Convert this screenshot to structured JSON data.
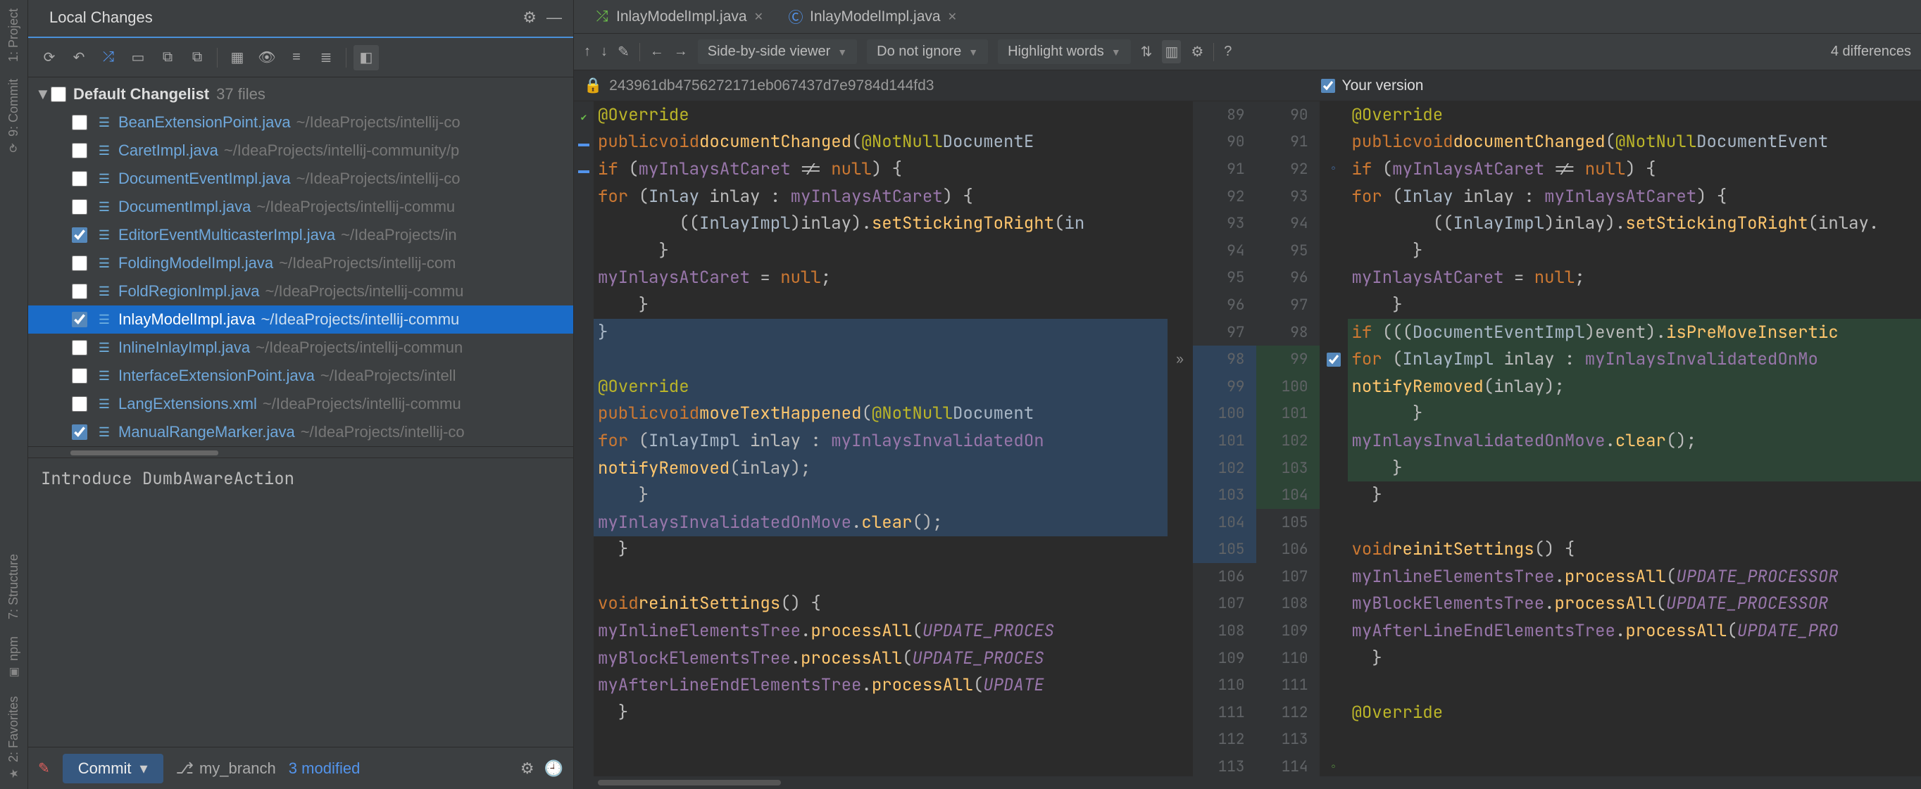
{
  "leftRail": {
    "project": "1: Project",
    "commit": "9: Commit",
    "structure": "7: Structure",
    "npm": "npm",
    "favorites": "2: Favorites"
  },
  "panel": {
    "title": "Local Changes"
  },
  "changelist": {
    "label": "Default Changelist",
    "count": "37 files"
  },
  "files": [
    {
      "name": "BeanExtensionPoint.java",
      "path": "~/IdeaProjects/intellij-co",
      "checked": false
    },
    {
      "name": "CaretImpl.java",
      "path": "~/IdeaProjects/intellij-community/p",
      "checked": false
    },
    {
      "name": "DocumentEventImpl.java",
      "path": "~/IdeaProjects/intellij-co",
      "checked": false
    },
    {
      "name": "DocumentImpl.java",
      "path": "~/IdeaProjects/intellij-commu",
      "checked": false
    },
    {
      "name": "EditorEventMulticasterImpl.java",
      "path": "~/IdeaProjects/in",
      "checked": true
    },
    {
      "name": "FoldingModelImpl.java",
      "path": "~/IdeaProjects/intellij-com",
      "checked": false
    },
    {
      "name": "FoldRegionImpl.java",
      "path": "~/IdeaProjects/intellij-commu",
      "checked": false
    },
    {
      "name": "InlayModelImpl.java",
      "path": "~/IdeaProjects/intellij-commu",
      "checked": true,
      "selected": true
    },
    {
      "name": "InlineInlayImpl.java",
      "path": "~/IdeaProjects/intellij-commun",
      "checked": false
    },
    {
      "name": "InterfaceExtensionPoint.java",
      "path": "~/IdeaProjects/intell",
      "checked": false
    },
    {
      "name": "LangExtensions.xml",
      "path": "~/IdeaProjects/intellij-commu",
      "checked": false
    },
    {
      "name": "ManualRangeMarker.java",
      "path": "~/IdeaProjects/intellij-co",
      "checked": true
    }
  ],
  "commitMessage": "Introduce DumbAwareAction",
  "footer": {
    "commitLabel": "Commit",
    "branch": "my_branch",
    "modified": "3 modified"
  },
  "tabs": [
    {
      "name": "InlayModelImpl.java",
      "iconColor": "green"
    },
    {
      "name": "InlayModelImpl.java",
      "iconColor": "blue"
    }
  ],
  "diffToolbar": {
    "viewer": "Side-by-side viewer",
    "ignore": "Do not ignore",
    "highlight": "Highlight words",
    "diffCount": "4 differences"
  },
  "diffHeader": {
    "leftRevision": "243961db4756272171eb067437d7e9784d144fd3",
    "right": "Your version"
  },
  "leftLines": [
    89,
    90,
    91,
    92,
    93,
    94,
    95,
    96,
    97,
    98,
    99,
    100,
    101,
    102,
    103,
    104,
    105,
    106,
    107,
    108,
    109,
    110,
    111,
    112,
    113
  ],
  "rightLines": [
    90,
    91,
    92,
    93,
    94,
    95,
    96,
    97,
    98,
    99,
    100,
    101,
    102,
    103,
    104,
    105,
    106,
    107,
    108,
    109,
    110,
    111,
    112,
    113,
    114
  ],
  "code": {
    "override": "@Override",
    "public": "public",
    "void": "void",
    "documentChanged": "documentChanged",
    "notNull": "@NotNull",
    "DocumentEvent": "DocumentEvent",
    "DocumentE": "DocumentE",
    "if": "if",
    "myInlaysAtCaret": "myInlaysAtCaret",
    "null": "null",
    "for": "for",
    "Inlay": "Inlay",
    "inlay": "inlay",
    "InlayImpl": "InlayImpl",
    "setStickingToRight": "setStickingToRight",
    "in": "in",
    "inlayDot": "inlay.",
    "moveTextHappened": "moveTextHappened",
    "Document": "Document",
    "myInlaysInvalidatedOn": "myInlaysInvalidatedOn",
    "myInlaysInvalidatedOnMo": "myInlaysInvalidatedOnMo",
    "myInlaysInvalidatedOnMove": "myInlaysInvalidatedOnMove",
    "notifyRemoved": "notifyRemoved",
    "clear": "clear",
    "reinitSettings": "reinitSettings",
    "myInlineElementsTree": "myInlineElementsTree",
    "myBlockElementsTree": "myBlockElementsTree",
    "myAfterLineEndElementsTree": "myAfterLineEndElementsTree",
    "processAll": "processAll",
    "UPDATE_PROCESSOR": "UPDATE_PROCESSOR",
    "UPDATE_PROCES": "UPDATE_PROCES",
    "UPDATE_PRO": "UPDATE_PRO",
    "UPDATE": "UPDATE",
    "DocumentEventImpl": "DocumentEventImpl",
    "event": "event",
    "isPreMoveInsertic": "isPreMoveInsertic"
  }
}
